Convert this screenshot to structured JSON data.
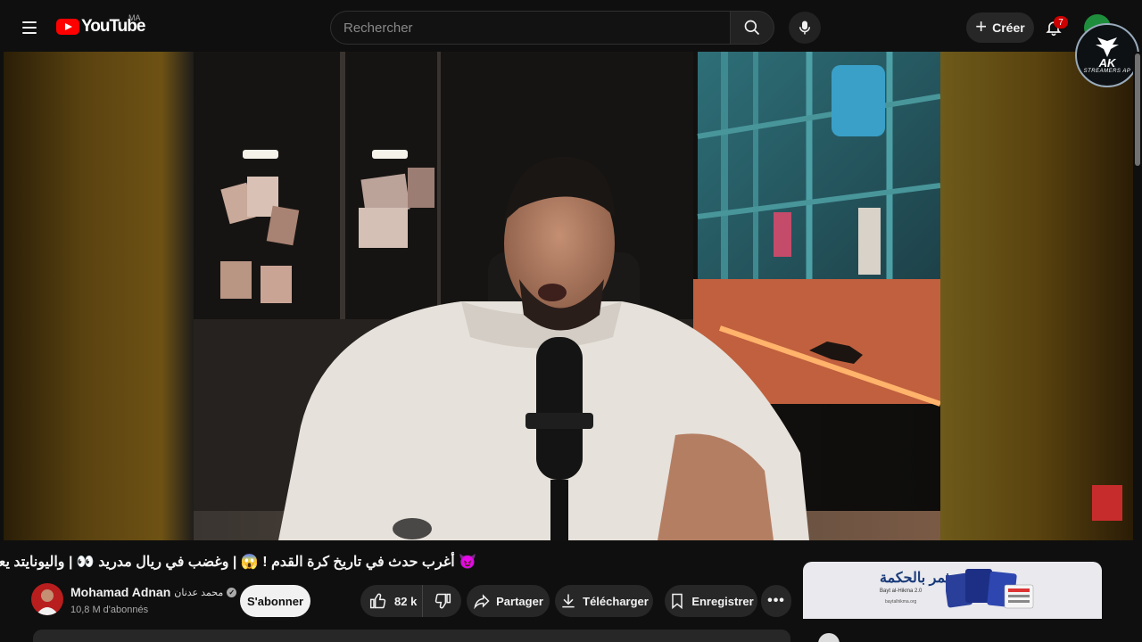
{
  "header": {
    "logo_text": "YouTube",
    "country_code": "MA",
    "search_placeholder": "Rechercher",
    "create_label": "Créer",
    "notifications_count": "7",
    "watermark_text": "AK",
    "watermark_sub": "STREAMERS AP"
  },
  "video": {
    "title": "😈 أغرب حدث في تاريخ كرة القدم ! 😱 | وغضب في ريال مدريد 👀 | واليونايتد يعود ؟",
    "channel_name": "Mohamad Adnan",
    "channel_name_ar": "محمد عدنان",
    "subscribers": "10,8 M d'abonnés",
    "subscribe_label": "S'abonner",
    "likes": "82 k",
    "share_label": "Partager",
    "download_label": "Télécharger",
    "save_label": "Enregistrer",
    "more_label": "•••"
  },
  "ad": {
    "brand": "استثمر بالحكمة",
    "brand_latin": "Bayt al-Hikma 2.0",
    "url": "baytalhikma.org"
  },
  "colors": {
    "background": "#0f0f0f",
    "accent_red": "#ff0000",
    "pill_bg": "#272727"
  }
}
